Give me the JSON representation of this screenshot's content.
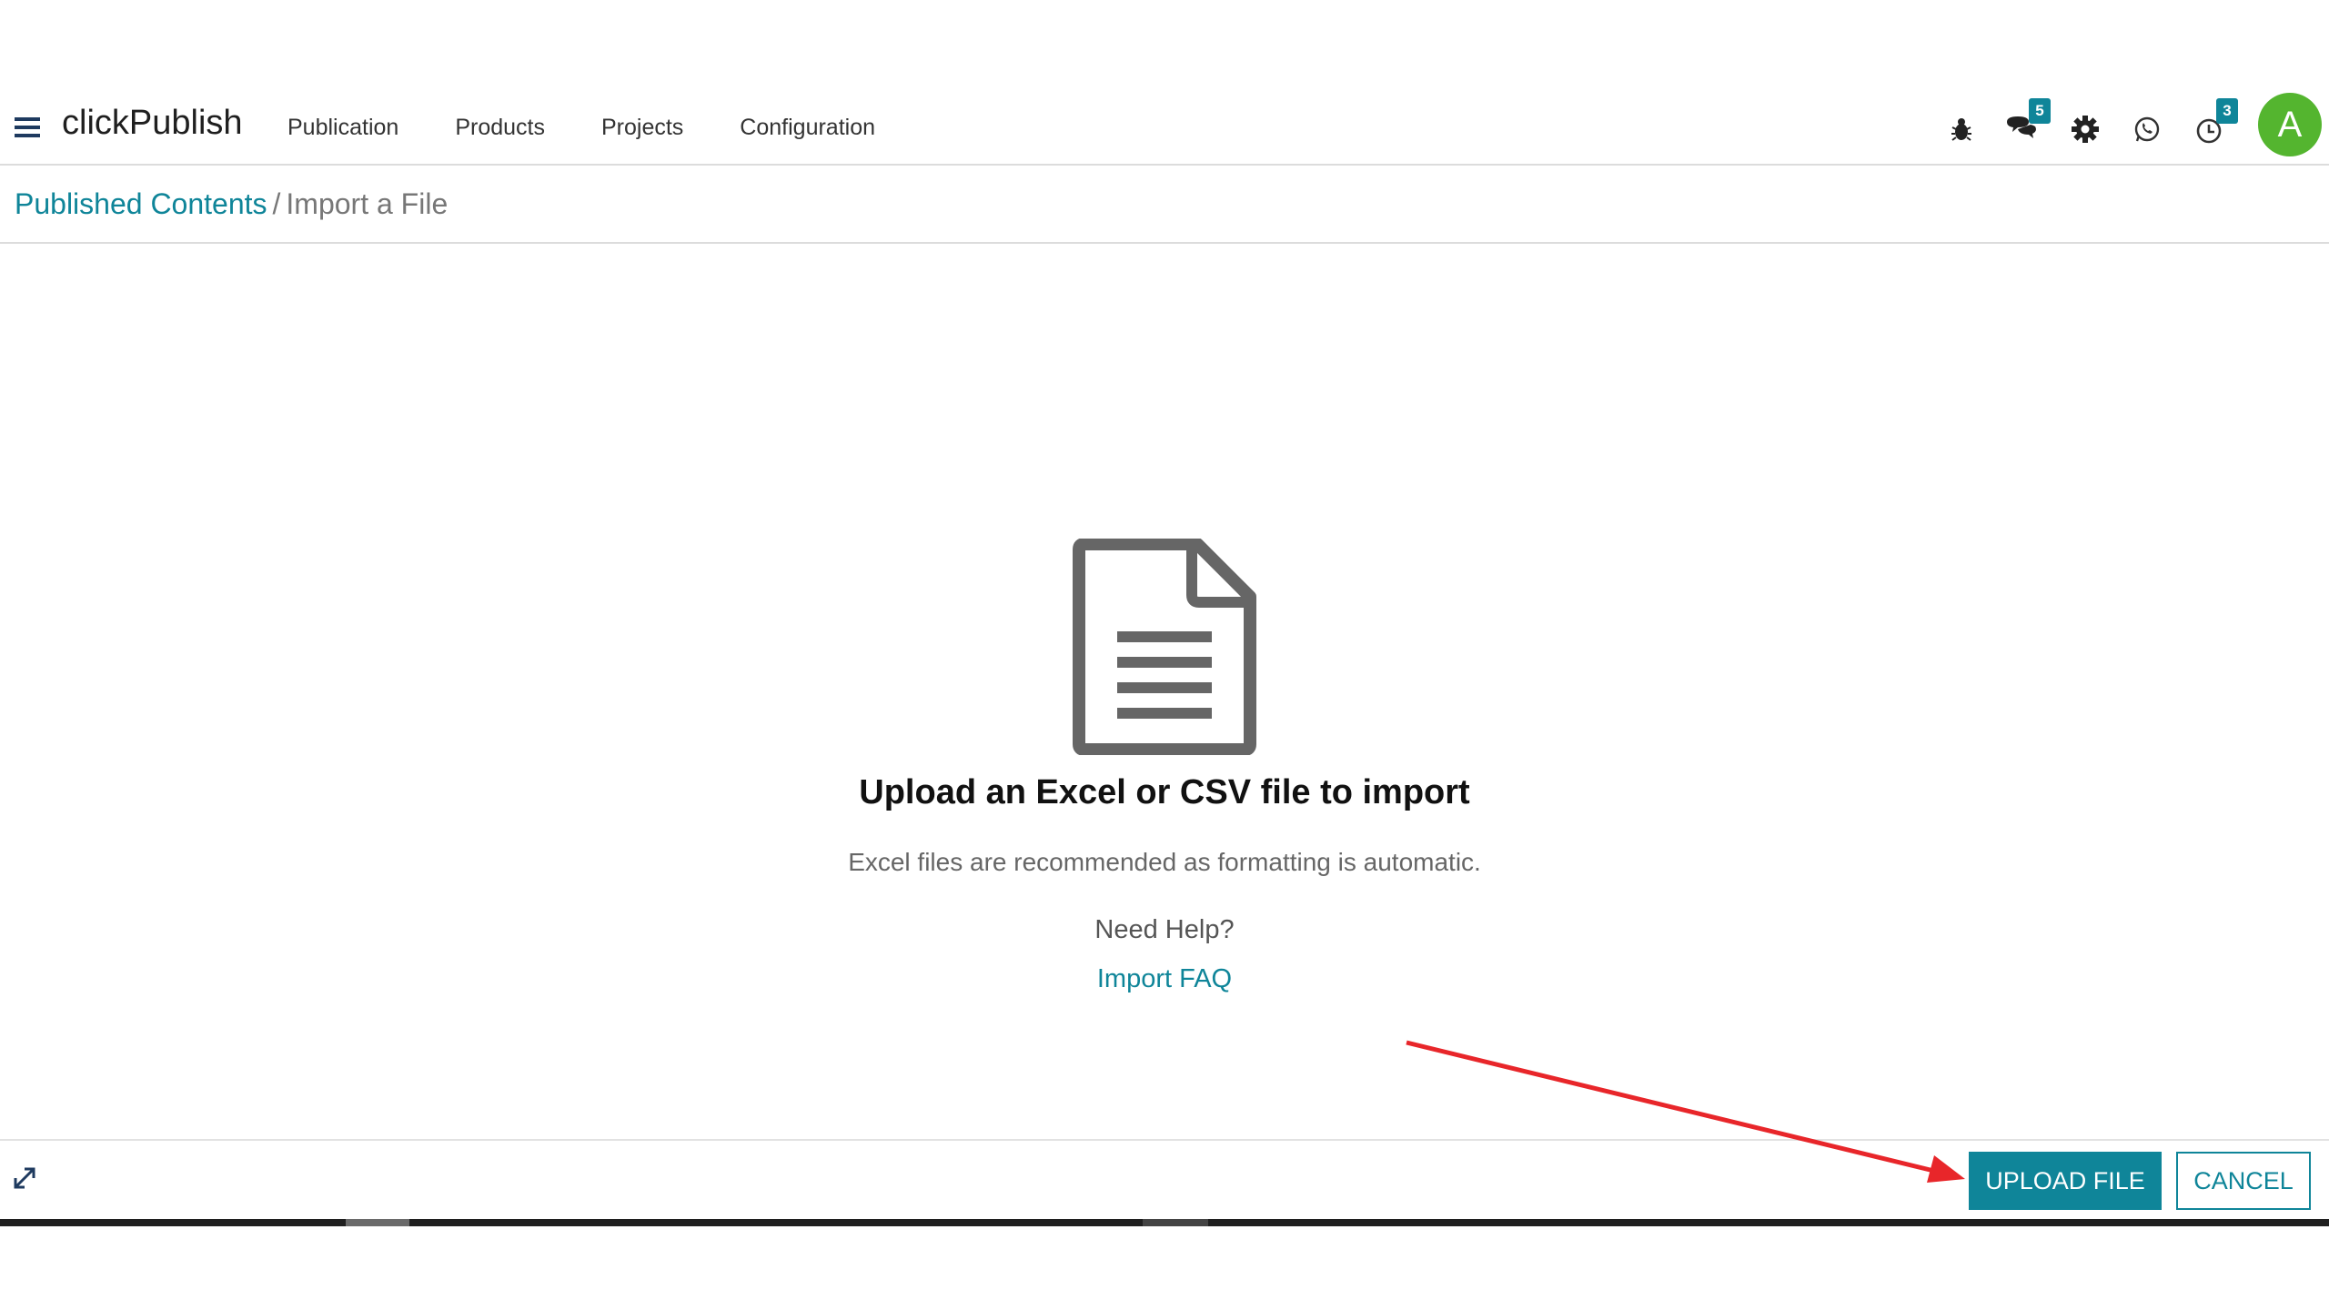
{
  "app": {
    "brand": "clickPublish",
    "menu": [
      "Publication",
      "Products",
      "Projects",
      "Configuration"
    ]
  },
  "systray": {
    "debug_icon": "bug-icon",
    "messages_icon": "chat-bubbles-icon",
    "messages_count": "5",
    "settings_icon": "gear-icon",
    "whatsapp_icon": "whatsapp-icon",
    "activity_icon": "clock-icon",
    "activity_count": "3",
    "avatar_letter": "A"
  },
  "breadcrumb": {
    "parent": "Published Contents",
    "separator": "/",
    "current": "Import a File"
  },
  "upload": {
    "icon": "file-text-icon",
    "title": "Upload an Excel or CSV file to import",
    "subtitle": "Excel files are recommended as formatting is automatic.",
    "help_title": "Need Help?",
    "help_link": "Import FAQ"
  },
  "footer": {
    "expand_icon": "expand-icon",
    "upload_button": "UPLOAD FILE",
    "cancel_button": "CANCEL"
  },
  "colors": {
    "accent": "#0f8599",
    "avatar": "#54b52f",
    "annotation_arrow": "#e8262a",
    "file_icon": "#666666"
  }
}
